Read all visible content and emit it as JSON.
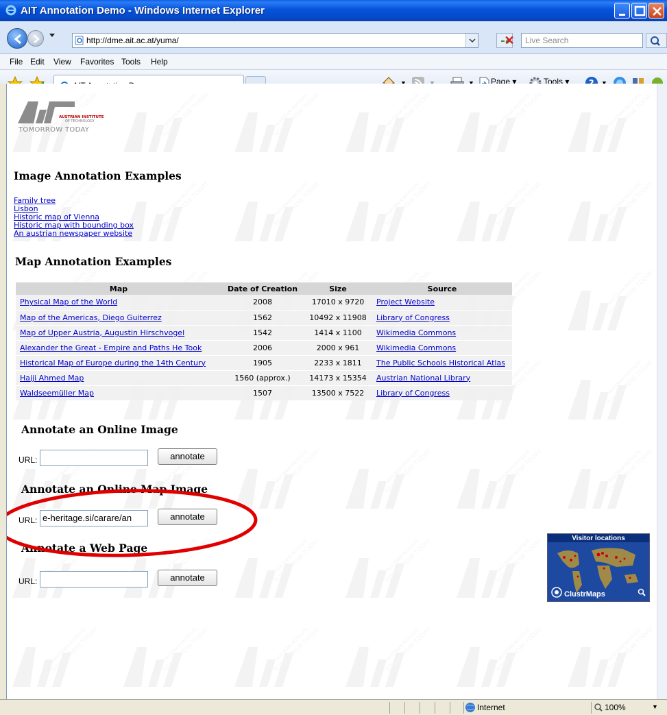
{
  "window": {
    "title": "AIT Annotation Demo - Windows Internet Explorer"
  },
  "address": {
    "url": "http://dme.ait.ac.at/yuma/",
    "search_placeholder": "Live Search"
  },
  "menu": [
    "File",
    "Edit",
    "View",
    "Favorites",
    "Tools",
    "Help"
  ],
  "tab": {
    "label": "AIT Annotation Demo"
  },
  "commandbar": {
    "page": "Page",
    "tools": "Tools"
  },
  "logo": {
    "big": "AIT",
    "line1": "AUSTRIAN INSTITUTE",
    "line2": "OF TECHNOLOGY",
    "tagline": "TOMORROW TODAY"
  },
  "image_section": {
    "heading": "Image Annotation Examples",
    "links": [
      "Family tree",
      "Lisbon",
      "Historic map of Vienna",
      "Historic map with bounding box",
      "An austrian newspaper website"
    ]
  },
  "map_section": {
    "heading": "Map Annotation Examples",
    "columns": [
      "Map",
      "Date of Creation",
      "Size",
      "Source"
    ],
    "rows": [
      [
        "Physical Map of the World",
        "2008",
        "17010 x 9720",
        "Project Website"
      ],
      [
        "Map of the Americas, Diego Guiterrez",
        "1562",
        "10492 x 11908",
        "Library of Congress"
      ],
      [
        "Map of Upper Austria, Augustin Hirschvogel",
        "1542",
        "1414 x 1100",
        "Wikimedia Commons"
      ],
      [
        "Alexander the Great - Empire and Paths He Took",
        "2006",
        "2000 x 961",
        "Wikimedia Commons"
      ],
      [
        "Historical Map of Europe during the 14th Century",
        "1905",
        "2233 x 1811",
        "The Public Schools Historical Atlas"
      ],
      [
        "Hajji Ahmed Map",
        "1560 (approx.)",
        "14173 x 15354",
        "Austrian National Library"
      ],
      [
        "Waldseemüller Map",
        "1507",
        "13500 x 7522",
        "Library of Congress"
      ]
    ]
  },
  "forms": {
    "online_image": {
      "heading": "Annotate an Online Image",
      "label": "URL:",
      "value": "",
      "button": "annotate"
    },
    "online_map": {
      "heading": "Annotate an Online Map Image",
      "label": "URL:",
      "value": "e-heritage.si/carare/an",
      "button": "annotate"
    },
    "web_page": {
      "heading": "Annotate a Web Page",
      "label": "URL:",
      "value": "",
      "button": "annotate"
    }
  },
  "clustrmaps": {
    "title": "Visitor locations",
    "brand": "ClustrMaps"
  },
  "status": {
    "zone": "Internet",
    "zoom": "100%"
  },
  "colors": {
    "link": "#0000cc",
    "title_bar": "#0553db",
    "annotation_circle": "#e00000"
  }
}
